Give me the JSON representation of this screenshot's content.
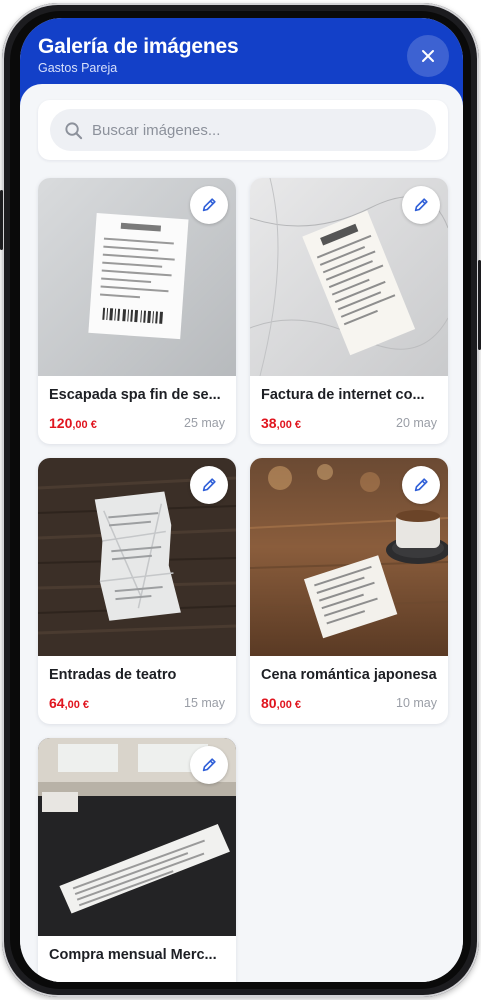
{
  "header": {
    "title": "Galería de imágenes",
    "subtitle": "Gastos Pareja",
    "close_icon": "close-icon"
  },
  "search": {
    "placeholder": "Buscar imágenes...",
    "value": "",
    "icon": "search-icon"
  },
  "colors": {
    "header_bg": "#1340c8",
    "amount": "#e0151f",
    "edit_icon": "#2f5fd8"
  },
  "gallery": [
    {
      "title": "Escapada spa fin de se...",
      "amount_int": "120",
      "amount_dec": ",00 €",
      "date": "25 may",
      "edit_icon": "pencil-icon"
    },
    {
      "title": "Factura de internet co...",
      "amount_int": "38",
      "amount_dec": ",00 €",
      "date": "20 may",
      "edit_icon": "pencil-icon"
    },
    {
      "title": "Entradas de teatro",
      "amount_int": "64",
      "amount_dec": ",00 €",
      "date": "15 may",
      "edit_icon": "pencil-icon"
    },
    {
      "title": "Cena romántica japonesa",
      "amount_int": "80",
      "amount_dec": ",00 €",
      "date": "10 may",
      "edit_icon": "pencil-icon"
    },
    {
      "title": "Compra mensual Merc...",
      "amount_int": "",
      "amount_dec": "",
      "date": "",
      "edit_icon": "pencil-icon"
    }
  ]
}
